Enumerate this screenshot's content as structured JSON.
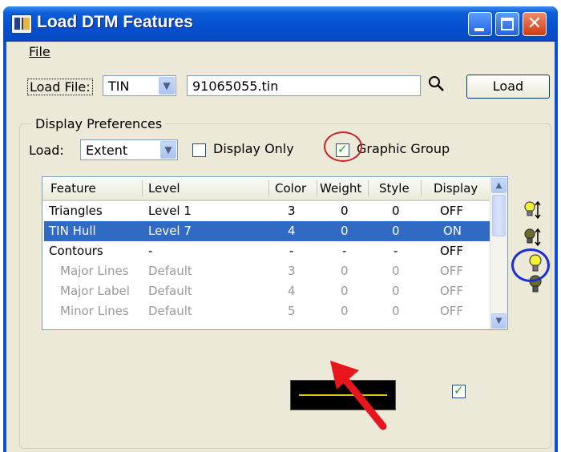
{
  "window": {
    "title": "Load DTM Features",
    "controls": {
      "minimize": "minimize",
      "maximize": "maximize",
      "close": "✕"
    }
  },
  "menu": {
    "file": "File"
  },
  "load_file": {
    "label": "Load File:",
    "type_value": "TIN",
    "filename": "91065055.tin",
    "load_button": "Load"
  },
  "display_preferences": {
    "legend": "Display Preferences",
    "load_label": "Load:",
    "load_value": "Extent",
    "display_only_label": "Display Only",
    "display_only_checked": false,
    "graphic_group_label": "Graphic Group",
    "graphic_group_checked": true
  },
  "table": {
    "columns": [
      "Feature",
      "Level",
      "Color",
      "Weight",
      "Style",
      "Display"
    ],
    "rows": [
      {
        "feature": "Triangles",
        "level": "Level 1",
        "color": "3",
        "weight": "0",
        "style": "0",
        "display": "OFF"
      },
      {
        "feature": "TIN Hull",
        "level": "Level 7",
        "color": "4",
        "weight": "0",
        "style": "0",
        "display": "ON"
      },
      {
        "feature": "Contours",
        "level": "-",
        "color": "-",
        "weight": "-",
        "style": "-",
        "display": "OFF"
      },
      {
        "feature": "Major Lines",
        "level": "Default",
        "color": "3",
        "weight": "0",
        "style": "0",
        "display": "OFF"
      },
      {
        "feature": "Major Label",
        "level": "Default",
        "color": "4",
        "weight": "0",
        "style": "0",
        "display": "OFF"
      },
      {
        "feature": "Minor Lines",
        "level": "Default",
        "color": "5",
        "weight": "0",
        "style": "0",
        "display": "OFF"
      }
    ],
    "selected_row": 1
  },
  "preview": {
    "line_color": "#d7c400",
    "background": "#000000"
  },
  "display_checkbox_checked": true,
  "icons": [
    "lightbulb-on-sort-icon",
    "lightbulb-off-sort-icon",
    "lightbulb-on-icon",
    "lightbulb-off-icon",
    "search-icon"
  ],
  "colors": {
    "selection": "#316ac5",
    "annotation_red": "#c0262c",
    "annotation_blue": "#1a2fd6",
    "titlebar": "#0550d0"
  }
}
